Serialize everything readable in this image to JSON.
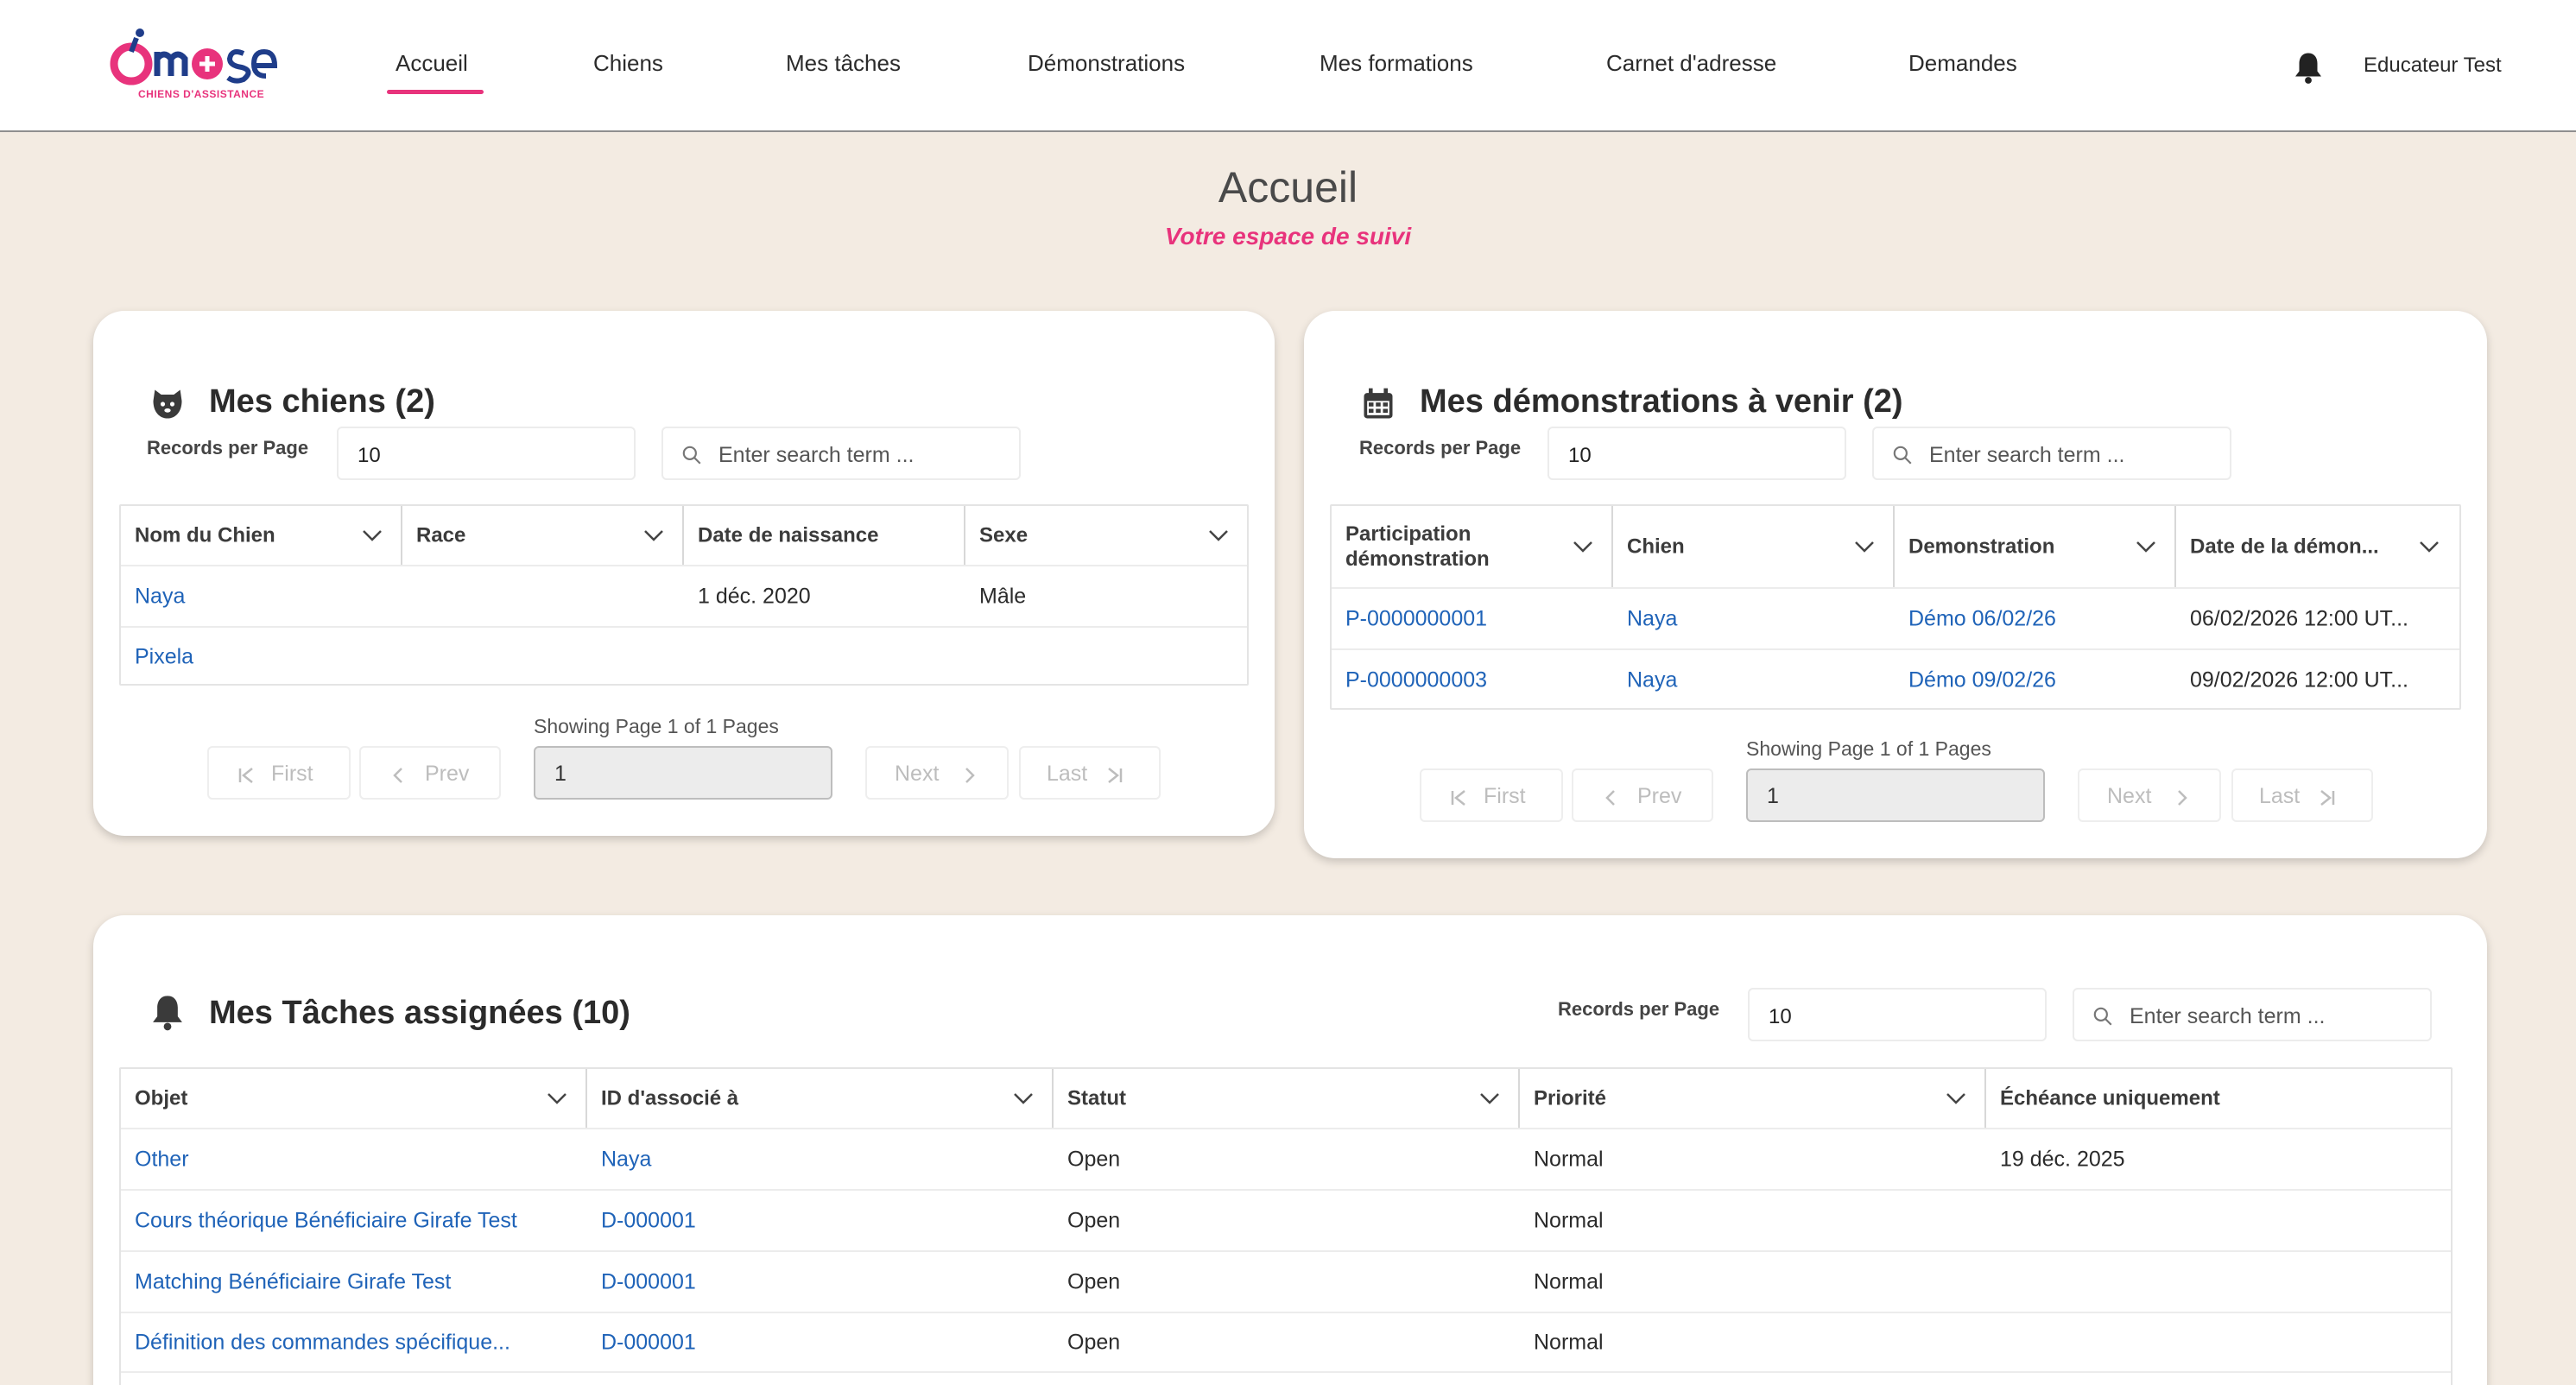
{
  "header": {
    "logo_text": "omose",
    "logo_subtext": "CHIENS D'ASSISTANCE",
    "nav": [
      "Accueil",
      "Chiens",
      "Mes tâches",
      "Démonstrations",
      "Mes formations",
      "Carnet d'adresse",
      "Demandes"
    ],
    "user": "Educateur Test",
    "brand_color": "#e8337c"
  },
  "page": {
    "title": "Accueil",
    "subtitle": "Votre espace de suivi"
  },
  "common": {
    "records_per_page_label": "Records per Page",
    "records_per_page_value": "10",
    "search_placeholder": "Enter search term ...",
    "pager_info": "Showing Page 1 of 1 Pages",
    "page_value": "1",
    "first": "First",
    "prev": "Prev",
    "next": "Next",
    "last": "Last"
  },
  "dogs": {
    "title": "Mes chiens (2)",
    "icon": "dog-icon",
    "columns": [
      "Nom du Chien",
      "Race",
      "Date de naissance",
      "Sexe"
    ],
    "rows": [
      [
        "Naya",
        "",
        "1 déc. 2020",
        "Mâle"
      ],
      [
        "Pixela",
        "",
        "",
        ""
      ]
    ]
  },
  "demos": {
    "title": "Mes démonstrations à venir (2)",
    "icon": "calendar-icon",
    "columns": [
      "Participation démonstration",
      "Chien",
      "Demonstration",
      "Date de la démon..."
    ],
    "rows": [
      [
        "P-0000000001",
        "Naya",
        "Démo 06/02/26",
        "06/02/2026 12:00 UT..."
      ],
      [
        "P-0000000003",
        "Naya",
        "Démo 09/02/26",
        "09/02/2026 12:00 UT..."
      ]
    ]
  },
  "tasks": {
    "title": "Mes Tâches assignées (10)",
    "icon": "bell-icon",
    "columns": [
      "Objet",
      "ID d'associé à",
      "Statut",
      "Priorité",
      "Échéance uniquement"
    ],
    "rows": [
      [
        "Other",
        "Naya",
        "Open",
        "Normal",
        "19 déc. 2025"
      ],
      [
        "Cours théorique Bénéficiaire Girafe Test",
        "D-000001",
        "Open",
        "Normal",
        ""
      ],
      [
        "Matching Bénéficiaire Girafe Test",
        "D-000001",
        "Open",
        "Normal",
        ""
      ],
      [
        "Définition des commandes spécifique...",
        "D-000001",
        "Open",
        "Normal",
        ""
      ]
    ]
  }
}
